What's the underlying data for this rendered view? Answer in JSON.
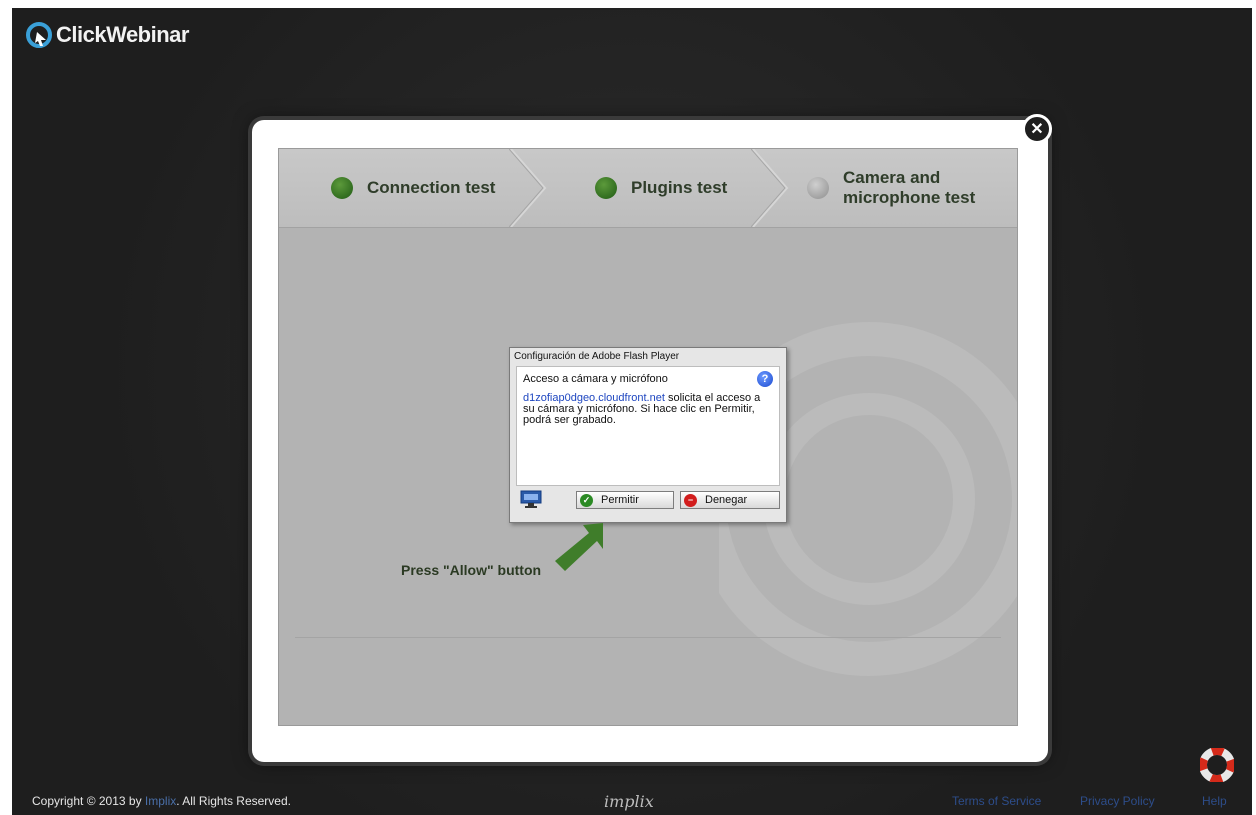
{
  "app": {
    "brand": "ClickWebinar"
  },
  "steps": [
    {
      "label_line1": "Connection test",
      "label_line2": "",
      "status": "done"
    },
    {
      "label_line1": "Plugins test",
      "label_line2": "",
      "status": "done"
    },
    {
      "label_line1": "Camera and",
      "label_line2": "microphone test",
      "status": "pending"
    }
  ],
  "flash_dialog": {
    "title": "Configuración de Adobe Flash Player",
    "heading": "Acceso a cámara y micrófono",
    "domain": "d1zofiap0dgeo.cloudfront.net",
    "message": " solicita el acceso a su cámara y micrófono. Si hace clic en Permitir, podrá ser grabado.",
    "allow_label": "Permitir",
    "deny_label": "Denegar"
  },
  "hint": {
    "text": "Press \"Allow\" button"
  },
  "footer": {
    "copyright_prefix": "Copyright © 2013 by ",
    "copyright_link": "Implix",
    "copyright_suffix": ". All Rights Reserved.",
    "implix_logo": "implix",
    "terms": "Terms of Service",
    "privacy": "Privacy Policy",
    "help": "Help"
  },
  "colors": {
    "background": "#232323",
    "step_done": "#2f6e1e",
    "step_pending": "#a0a0a0",
    "arrow": "#3f7d2a",
    "link": "#2d4d8a"
  },
  "icons": [
    "logo-icon",
    "close-icon",
    "help-icon",
    "monitor-icon",
    "check-icon",
    "deny-icon",
    "arrow-icon",
    "lifebuoy-icon"
  ]
}
